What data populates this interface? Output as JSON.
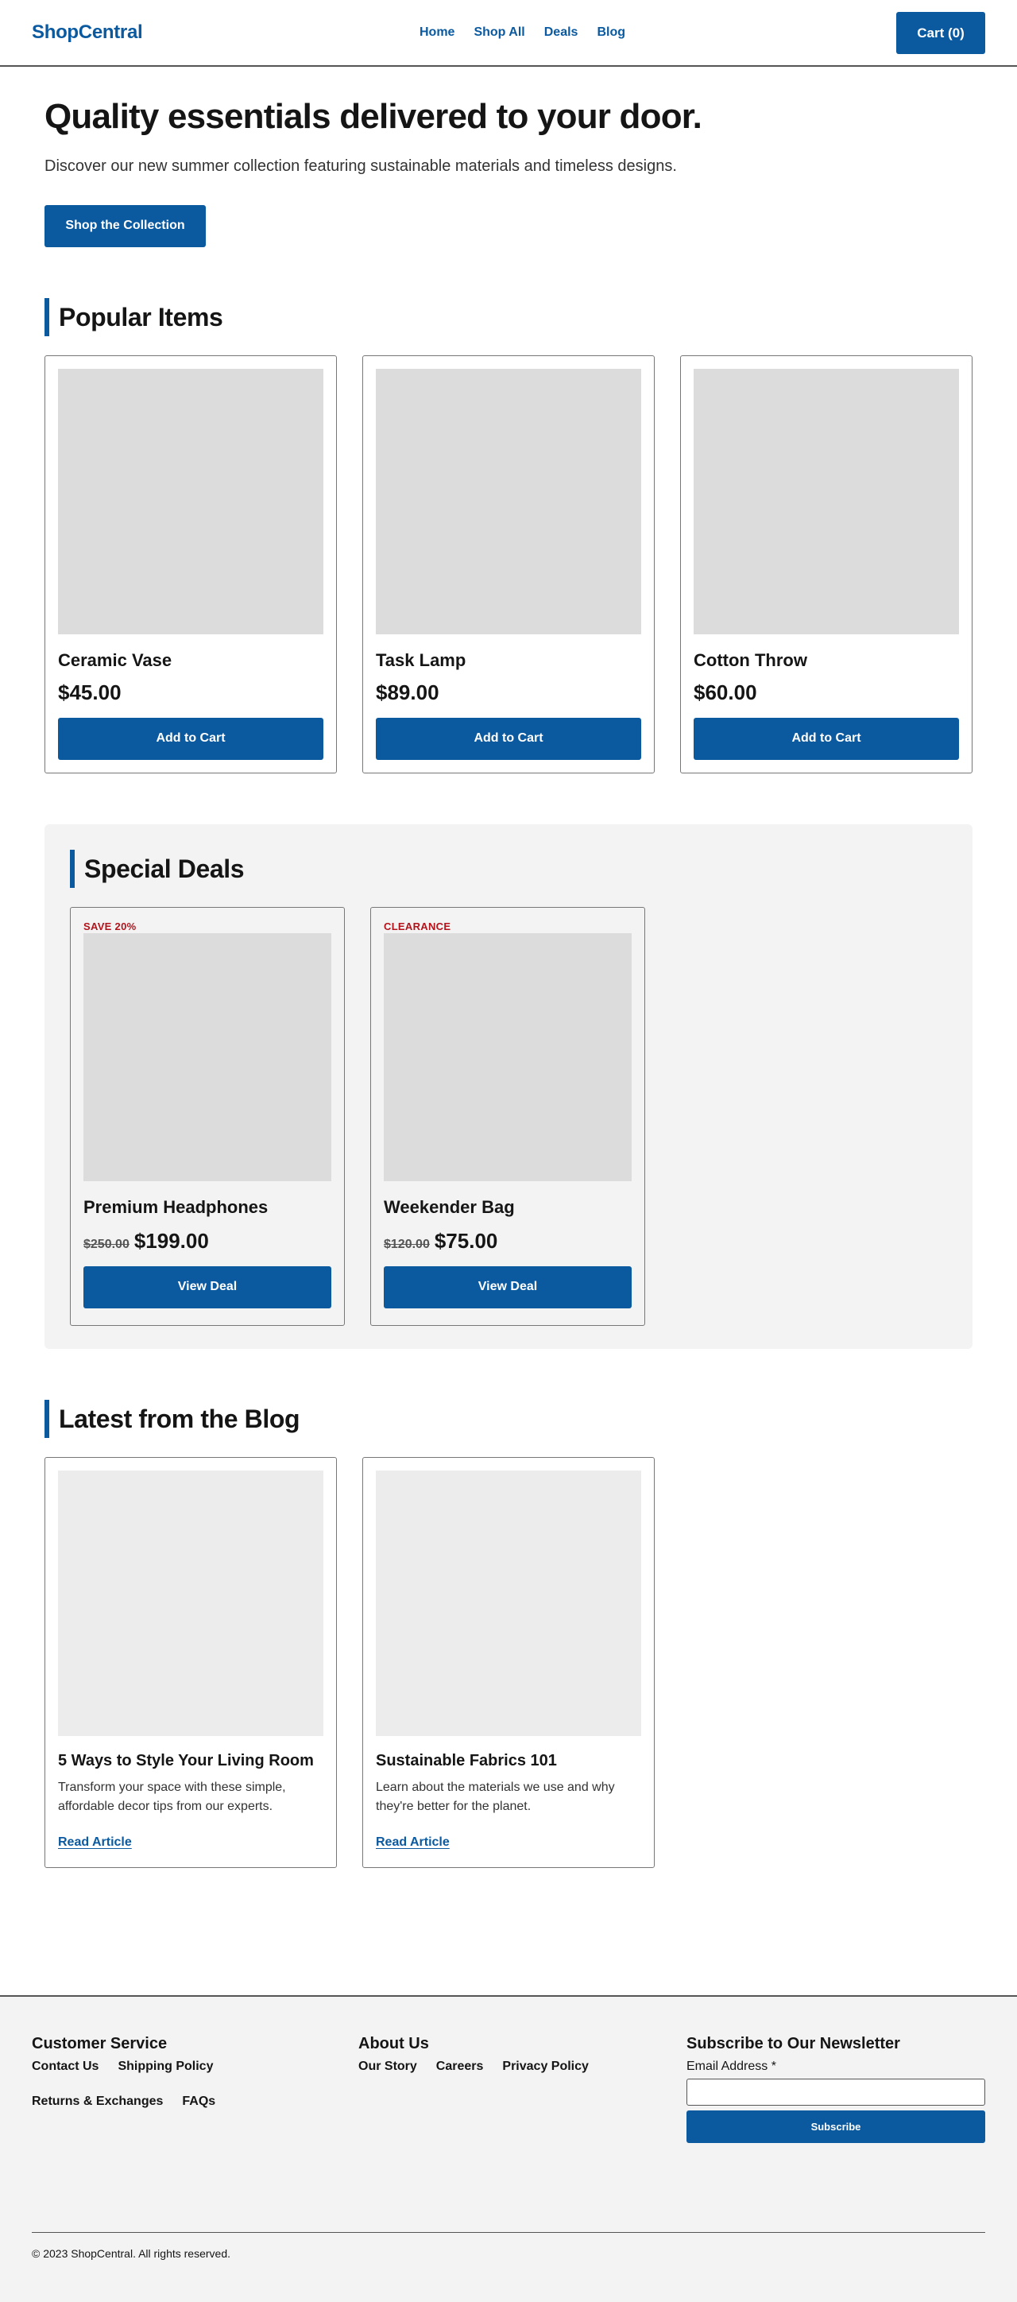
{
  "header": {
    "logo": "ShopCentral",
    "nav": [
      "Home",
      "Shop All",
      "Deals",
      "Blog"
    ],
    "cart_label": "Cart (0)"
  },
  "hero": {
    "title": "Quality essentials delivered to your door.",
    "subtitle": "Discover our new summer collection featuring sustainable materials and timeless designs.",
    "cta": "Shop the Collection"
  },
  "popular": {
    "title": "Popular Items",
    "items": [
      {
        "name": "Ceramic Vase",
        "price": "$45.00",
        "button": "Add to Cart"
      },
      {
        "name": "Task Lamp",
        "price": "$89.00",
        "button": "Add to Cart"
      },
      {
        "name": "Cotton Throw",
        "price": "$60.00",
        "button": "Add to Cart"
      }
    ]
  },
  "deals": {
    "title": "Special Deals",
    "items": [
      {
        "badge": "SAVE 20%",
        "name": "Premium Headphones",
        "old_price": "$250.00",
        "new_price": "$199.00",
        "button": "View Deal"
      },
      {
        "badge": "CLEARANCE",
        "name": "Weekender Bag",
        "old_price": "$120.00",
        "new_price": "$75.00",
        "button": "View Deal"
      }
    ]
  },
  "blog": {
    "title": "Latest from the Blog",
    "posts": [
      {
        "title": "5 Ways to Style Your Living Room",
        "excerpt": "Transform your space with these simple, affordable decor tips from our experts.",
        "link": "Read Article"
      },
      {
        "title": "Sustainable Fabrics 101",
        "excerpt": "Learn about the materials we use and why they're better for the planet.",
        "link": "Read Article"
      }
    ]
  },
  "footer": {
    "service": {
      "title": "Customer Service",
      "links": [
        "Contact Us",
        "Shipping Policy",
        "Returns & Exchanges",
        "FAQs"
      ]
    },
    "about": {
      "title": "About Us",
      "links": [
        "Our Story",
        "Careers",
        "Privacy Policy"
      ]
    },
    "newsletter": {
      "title": "Subscribe to Our Newsletter",
      "email_label": "Email Address *",
      "email_value": "",
      "button": "Subscribe"
    },
    "copyright": "© 2023 ShopCentral. All rights reserved."
  },
  "colors": {
    "brand": "#0b5aa0",
    "badge": "#b3131b",
    "panel": "#f3f3f3",
    "placeholder": "#dcdcdc"
  }
}
